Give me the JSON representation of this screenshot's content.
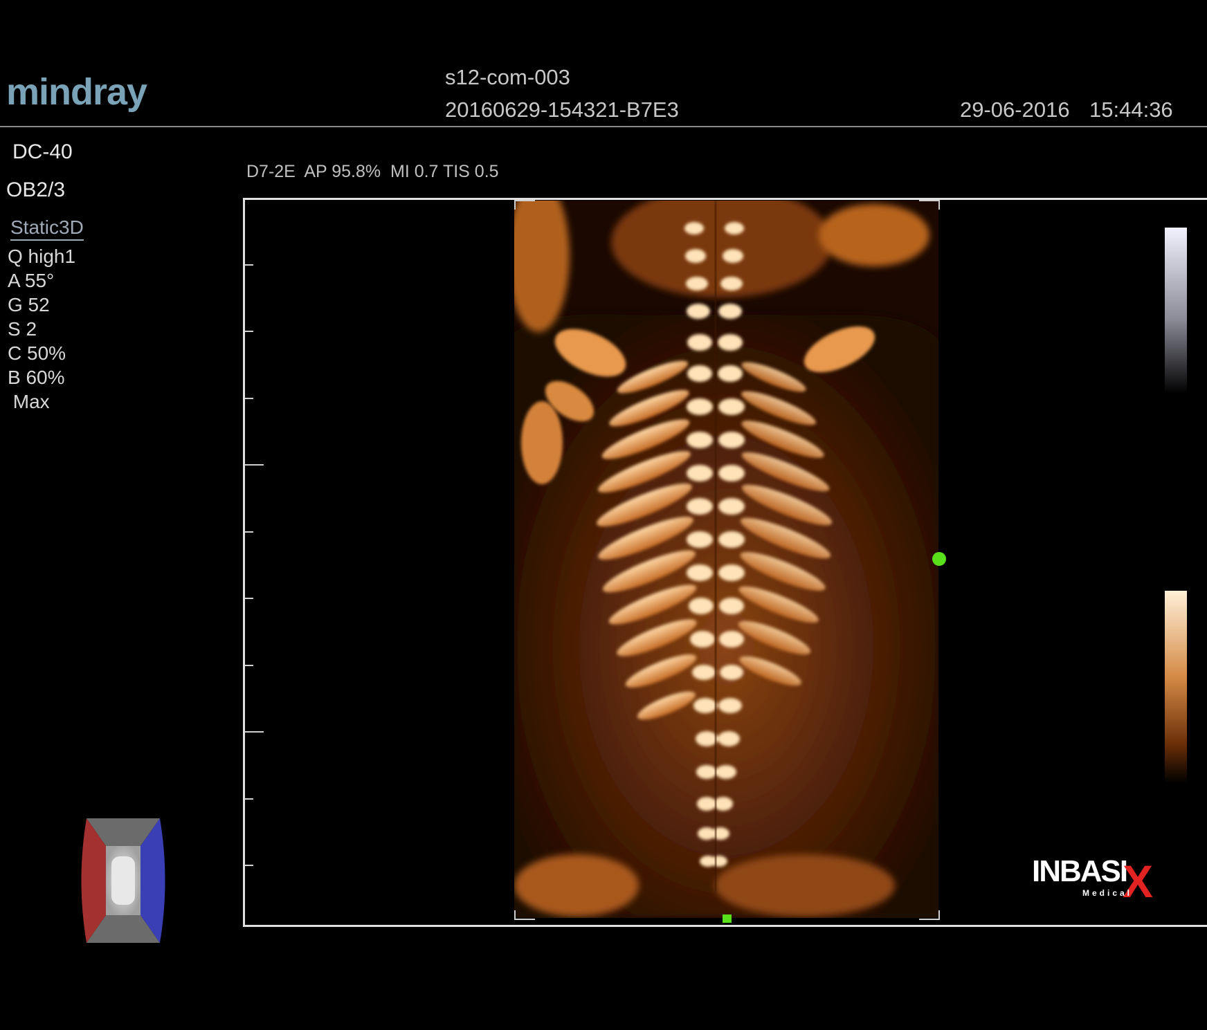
{
  "header": {
    "logo": "mindray",
    "patient_id": "s12-com-003",
    "exam_id": "20160629-154321-B7E3",
    "date": "29-06-2016",
    "time": "15:44:36"
  },
  "sidebar": {
    "device": "DC-40",
    "preset": "OB2/3",
    "mode": "Static3D",
    "params": [
      "Q high1",
      "A 55°",
      "G 52",
      "S 2",
      "C 50%",
      "B 60%",
      " Max"
    ]
  },
  "probe_info": "D7-2E  AP 95.8%  MI 0.7 TIS 0.5",
  "watermark": {
    "brand": "INBASI",
    "brand_x": "X",
    "sub": "Medical"
  },
  "colors": {
    "background": "#000000",
    "marker": "#5ae01a",
    "logo": "#7aa3b8",
    "render_tint": "#c8732a",
    "brand_red": "#e32222"
  },
  "icons": [
    "orientation-cube-icon",
    "3d-marker-dot-icon"
  ]
}
